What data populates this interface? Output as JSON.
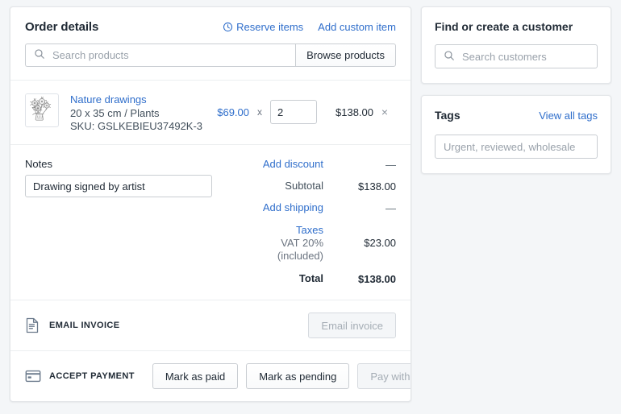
{
  "order": {
    "title": "Order details",
    "reserve_items_label": "Reserve items",
    "add_custom_item_label": "Add custom item",
    "search": {
      "placeholder": "Search products",
      "icon": "search-icon"
    },
    "browse_button_label": "Browse products",
    "line_items": [
      {
        "title": "Nature drawings",
        "variant": "20 x 35 cm / Plants",
        "sku": "SKU: GSLKEBIEU37492K-3",
        "unit_price": "$69.00",
        "multiply_symbol": "x",
        "quantity": "2",
        "line_total": "$138.00",
        "remove_symbol": "×",
        "thumbnail_alt": "pencil-sketch-of-flowers"
      }
    ],
    "notes": {
      "label": "Notes",
      "value": "Drawing signed by artist",
      "placeholder": ""
    },
    "totals": [
      {
        "label": "Add discount",
        "value": "—",
        "is_link": true
      },
      {
        "label": "Subtotal",
        "value": "$138.00",
        "is_link": false
      },
      {
        "label": "Add shipping",
        "value": "—",
        "is_link": true
      }
    ],
    "taxes": {
      "link_label": "Taxes",
      "detail": "VAT 20%",
      "detail2": "(included)",
      "value": "$23.00"
    },
    "total": {
      "label": "Total",
      "value": "$138.00"
    },
    "email_invoice": {
      "icon": "invoice-document-icon",
      "label": "EMAIL INVOICE",
      "button_label": "Email invoice",
      "button_disabled": true
    },
    "accept_payment": {
      "icon": "credit-card-icon",
      "label": "ACCEPT PAYMENT",
      "buttons": [
        {
          "label": "Mark as paid",
          "disabled": false
        },
        {
          "label": "Mark as pending",
          "disabled": false
        },
        {
          "label": "Pay with credit card",
          "disabled": true
        }
      ]
    }
  },
  "customer_card": {
    "title": "Find or create a customer",
    "search_placeholder": "Search customers",
    "search_icon": "search-icon"
  },
  "tags_card": {
    "title": "Tags",
    "view_all_label": "View all tags",
    "input_placeholder": "Urgent, reviewed, wholesale",
    "input_value": ""
  },
  "colors": {
    "link": "#2f6ecb",
    "page_bg": "#f4f6f8",
    "card_bg": "#ffffff",
    "border": "#c9cdd2",
    "text": "#212b36",
    "muted": "#6b7480"
  }
}
